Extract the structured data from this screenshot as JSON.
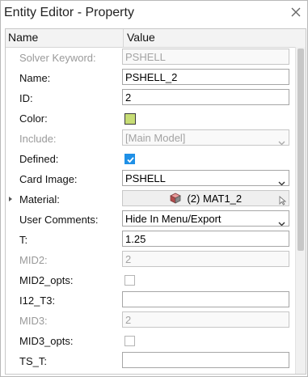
{
  "window": {
    "title": "Entity Editor - Property"
  },
  "table": {
    "header_name": "Name",
    "header_value": "Value"
  },
  "rows": [
    {
      "label": "Solver Keyword:",
      "value": "PSHELL"
    },
    {
      "label": "Name:",
      "value": "PSHELL_2"
    },
    {
      "label": "ID:",
      "value": "2"
    },
    {
      "label": "Color:",
      "color": "#c7dd75"
    },
    {
      "label": "Include:",
      "value": "[Main Model]"
    },
    {
      "label": "Defined:",
      "checked": true
    },
    {
      "label": "Card Image:",
      "value": "PSHELL"
    },
    {
      "label": "Material:",
      "value": "(2) MAT1_2"
    },
    {
      "label": "User Comments:",
      "value": "Hide In Menu/Export"
    },
    {
      "label": "T:",
      "value": "1.25"
    },
    {
      "label": "MID2:",
      "value": "2"
    },
    {
      "label": "MID2_opts:",
      "checked": false
    },
    {
      "label": "I12_T3:",
      "value": ""
    },
    {
      "label": "MID3:",
      "value": "2"
    },
    {
      "label": "MID3_opts:",
      "checked": false
    },
    {
      "label": "TS_T:",
      "value": ""
    }
  ],
  "colors": {
    "checkbox_on": "#1f90e6",
    "swatch": "#c7dd75",
    "disabled_text": "#9a9a9a"
  }
}
